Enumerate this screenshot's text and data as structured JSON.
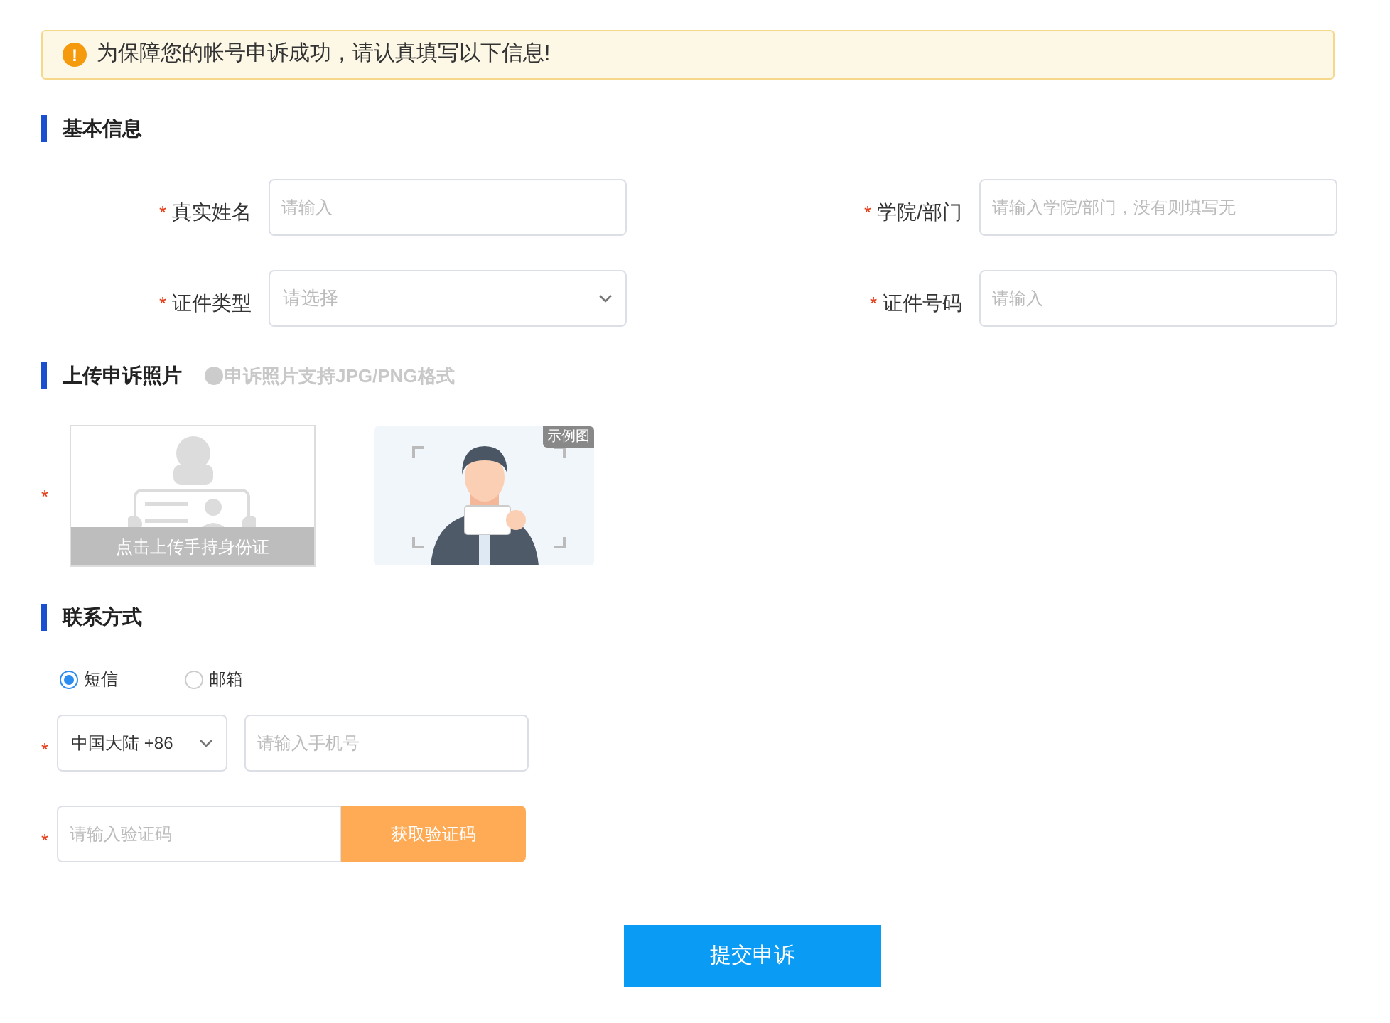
{
  "notice": {
    "icon_text": "!",
    "text": "为保障您的帐号申诉成功，请认真填写以下信息!"
  },
  "basic_info": {
    "title": "基本信息",
    "fields": [
      {
        "kind": "input",
        "required_mark": "*",
        "label": "真实姓名",
        "placeholder": "请输入"
      },
      {
        "kind": "input",
        "required_mark": "*",
        "label": "学院/部门",
        "placeholder": "请输入学院/部门，没有则填写无"
      },
      {
        "kind": "select",
        "required_mark": "*",
        "label": "证件类型",
        "placeholder": "请选择"
      },
      {
        "kind": "input",
        "required_mark": "*",
        "label": "证件号码",
        "placeholder": "请输入"
      }
    ]
  },
  "photo": {
    "title": "上传申诉照片",
    "hint": "申诉照片支持JPG/PNG格式",
    "required_mark": "*",
    "upload_label": "点击上传手持身份证",
    "example_badge": "示例图"
  },
  "contact": {
    "title": "联系方式",
    "methods": [
      {
        "label": "短信",
        "selected": true
      },
      {
        "label": "邮箱",
        "selected": false
      }
    ],
    "phone": {
      "required_mark": "*",
      "region": "中国大陆 +86",
      "placeholder": "请输入手机号"
    },
    "code": {
      "required_mark": "*",
      "placeholder": "请输入验证码",
      "button": "获取验证码"
    }
  },
  "submit": "提交申诉"
}
